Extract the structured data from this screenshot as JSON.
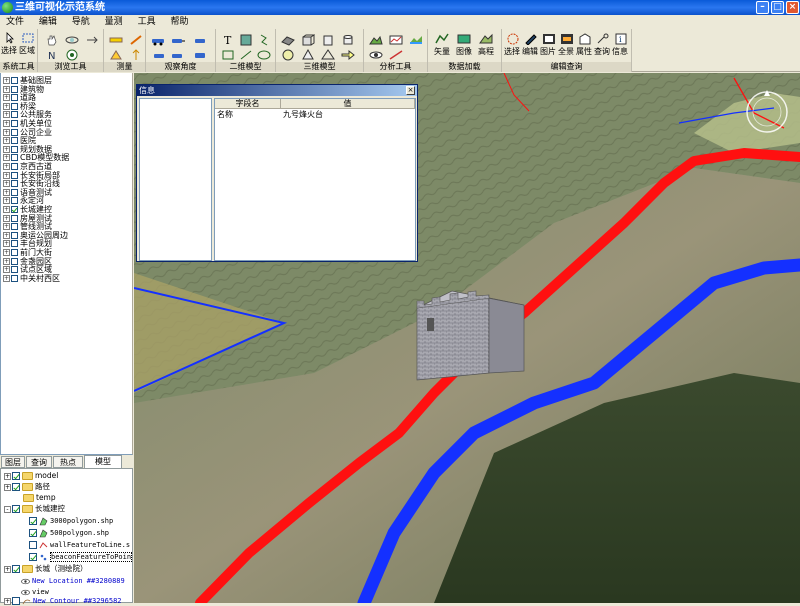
{
  "app": {
    "title": "三维可视化示范系统"
  },
  "menu": [
    "文件",
    "编辑",
    "导航",
    "量测",
    "工具",
    "帮助"
  ],
  "ribbon": {
    "groups": [
      {
        "caption": "系统工具",
        "buttons": [
          "选择",
          "区域"
        ]
      },
      {
        "caption": "浏览工具",
        "buttons": []
      },
      {
        "caption": "测量",
        "buttons": []
      },
      {
        "caption": "观察角度",
        "buttons": []
      },
      {
        "caption": "二维模型",
        "buttons": []
      },
      {
        "caption": "三维模型",
        "buttons": []
      },
      {
        "caption": "分析工具",
        "buttons": []
      },
      {
        "caption": "数据加载",
        "buttons": [
          "矢量",
          "图像",
          "高程"
        ]
      },
      {
        "caption": "编辑查询",
        "buttons": [
          "选择",
          "编辑",
          "图片",
          "全景",
          "属性",
          "查询",
          "信息"
        ]
      }
    ]
  },
  "layer_tree": [
    {
      "label": "基础图层",
      "checked": false
    },
    {
      "label": "建筑物",
      "checked": false
    },
    {
      "label": "道路",
      "checked": false
    },
    {
      "label": "桥梁",
      "checked": false
    },
    {
      "label": "公共服务",
      "checked": false
    },
    {
      "label": "机关单位",
      "checked": false
    },
    {
      "label": "公司企业",
      "checked": false
    },
    {
      "label": "医院",
      "checked": false
    },
    {
      "label": "规划数据",
      "checked": false
    },
    {
      "label": "CBD模型数据",
      "checked": false
    },
    {
      "label": "京西古道",
      "checked": false
    },
    {
      "label": "长安街局部",
      "checked": false
    },
    {
      "label": "长安街沿线",
      "checked": false
    },
    {
      "label": "语音测试",
      "checked": false
    },
    {
      "label": "永定河",
      "checked": false
    },
    {
      "label": "长城建控",
      "checked": true
    },
    {
      "label": "房屋测试",
      "checked": false
    },
    {
      "label": "管线测试",
      "checked": false
    },
    {
      "label": "奥运公园周边",
      "checked": false
    },
    {
      "label": "丰台规划",
      "checked": false
    },
    {
      "label": "前门大街",
      "checked": false
    },
    {
      "label": "金盏园区",
      "checked": false
    },
    {
      "label": "试点区域",
      "checked": false
    },
    {
      "label": "中关村西区",
      "checked": false
    }
  ],
  "tabs": [
    "图层",
    "查询",
    "热点",
    "模型"
  ],
  "model_tree": {
    "items": [
      {
        "label": "model",
        "type": "folder",
        "checked": true,
        "expander": "+"
      },
      {
        "label": "路径",
        "type": "folder",
        "checked": true,
        "expander": "+"
      },
      {
        "label": "temp",
        "type": "folder",
        "checked": null,
        "expander": ""
      },
      {
        "label": "长城建控",
        "type": "folder",
        "checked": true,
        "expander": "-"
      },
      {
        "label": "3000polygon.shp",
        "type": "layer",
        "checked": true
      },
      {
        "label": "500polygon.shp",
        "type": "layer",
        "checked": true
      },
      {
        "label": "wallFeatureToLine.s",
        "type": "layer",
        "checked": false
      },
      {
        "label": "beaconFeatureToPoin",
        "type": "layer",
        "checked": true
      },
      {
        "label": "长城（测绘院）",
        "type": "folder",
        "checked": true,
        "expander": "+"
      },
      {
        "label": "New Location ##3280889",
        "type": "location"
      },
      {
        "label": "view",
        "type": "location"
      },
      {
        "label": "New Contour ##3296582",
        "type": "contour"
      }
    ]
  },
  "info_dialog": {
    "title": "信息",
    "columns": [
      "字段名",
      "值"
    ],
    "rows": [
      {
        "field": "名称",
        "value": "九号烽火台"
      }
    ]
  },
  "colors": {
    "red_route": "#ff1010",
    "blue_route": "#1430ff",
    "title_bar": "#0a5ad8"
  }
}
